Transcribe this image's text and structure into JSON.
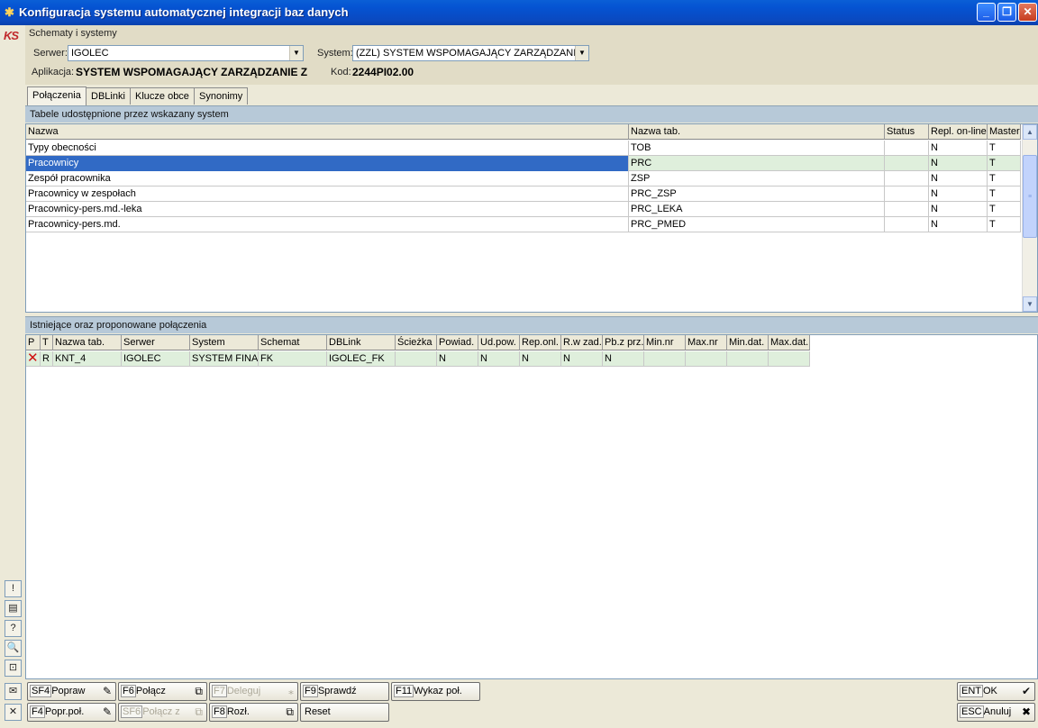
{
  "window": {
    "title": "Konfiguracja systemu automatycznej integracji baz danych",
    "minimize": "_",
    "restore": "❐",
    "close": "✕"
  },
  "logo": "KS",
  "header": {
    "section": "Schematy i systemy",
    "server_label": "Serwer:",
    "server_value": "IGOLEC",
    "system_label": "System:",
    "system_value": "(ZZL) SYSTEM WSPOMAGAJĄCY ZARZĄDZANI",
    "app_label": "Aplikacja:",
    "app_value": "SYSTEM WSPOMAGAJĄCY ZARZĄDZANIE Z",
    "code_label": "Kod:",
    "code_value": "2244PI02.00"
  },
  "tabs": [
    "Połączenia",
    "DBLinki",
    "Klucze obce",
    "Synonimy"
  ],
  "tables_section": {
    "title": "Tabele udostępnione przez wskazany system",
    "columns": [
      "Nazwa",
      "Nazwa tab.",
      "Status",
      "Repl. on-line",
      "Master"
    ],
    "rows": [
      [
        "Typy obecności",
        "TOB",
        "",
        "N",
        "T"
      ],
      [
        "Pracownicy",
        "PRC",
        "",
        "N",
        "T"
      ],
      [
        "Zespół pracownika",
        "ZSP",
        "",
        "N",
        "T"
      ],
      [
        "Pracownicy w zespołach",
        "PRC_ZSP",
        "",
        "N",
        "T"
      ],
      [
        "Pracownicy-pers.md.-leka",
        "PRC_LEKA",
        "",
        "N",
        "T"
      ],
      [
        "Pracownicy-pers.md.",
        "PRC_PMED",
        "",
        "N",
        "T"
      ]
    ]
  },
  "links_section": {
    "title": "Istniejące oraz proponowane połączenia",
    "columns": [
      "P",
      "T",
      "Nazwa tab.",
      "Serwer",
      "System",
      "Schemat",
      "DBLink",
      "Ścieżka",
      "Powiad.",
      "Ud.pow.",
      "Rep.onl.",
      "R.w zad.",
      "Pb.z prz.",
      "Min.nr",
      "Max.nr",
      "Min.dat.",
      "Max.dat."
    ],
    "rows": [
      [
        "✕",
        "R",
        "KNT_4",
        "IGOLEC",
        "SYSTEM FINAI",
        "FK",
        "IGOLEC_FK",
        "",
        "N",
        "N",
        "N",
        "N",
        "N",
        "",
        "",
        "",
        ""
      ]
    ]
  },
  "side_buttons": [
    "!",
    "▤",
    "?",
    "🔍",
    "⊡"
  ],
  "bottom": {
    "row1": [
      {
        "key": "SF4",
        "label": "Popraw",
        "icon": "✎"
      },
      {
        "key": "F6",
        "label": "Połącz",
        "icon": "⧉"
      },
      {
        "key": "F7",
        "label": "Deleguj",
        "icon": "⁎"
      },
      {
        "key": "F9",
        "label": "Sprawdź",
        "icon": ""
      },
      {
        "key": "F11",
        "label": "Wykaz poł.",
        "icon": ""
      }
    ],
    "row2": [
      {
        "key": "F4",
        "label": "Popr.poł.",
        "icon": "✎"
      },
      {
        "key": "SF6",
        "label": "Połącz z",
        "icon": "⧉"
      },
      {
        "key": "F8",
        "label": "Rozł.",
        "icon": "⧉"
      },
      {
        "key": "",
        "label": "Reset",
        "icon": ""
      }
    ],
    "ok": {
      "key": "ENT",
      "label": "OK",
      "icon": "✔"
    },
    "cancel": {
      "key": "ESC",
      "label": "Anuluj",
      "icon": "✖"
    },
    "left_icons": [
      "✉",
      "✕"
    ]
  }
}
